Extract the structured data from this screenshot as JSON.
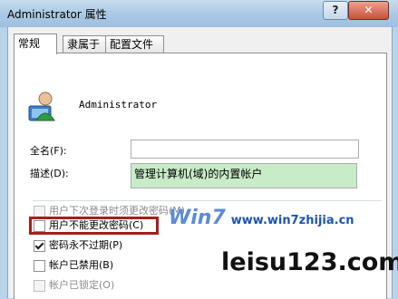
{
  "window": {
    "title": "Administrator 属性",
    "help_label": "?",
    "close_label": "✕"
  },
  "tabs": [
    {
      "label": "常规",
      "active": true
    },
    {
      "label": "隶属于",
      "active": false
    },
    {
      "label": "配置文件",
      "active": false
    }
  ],
  "user": {
    "name": "Administrator",
    "avatar_icon": "user-icon"
  },
  "form": {
    "fullname_label": "全名(F):",
    "fullname_value": "",
    "description_label": "描述(D):",
    "description_value": "管理计算机(域)的内置帐户"
  },
  "options": [
    {
      "label": "用户下次登录时须更改密码(M)",
      "checked": false,
      "disabled": true
    },
    {
      "label": "用户不能更改密码(C)",
      "checked": false,
      "disabled": false,
      "highlighted": true
    },
    {
      "label": "密码永不过期(P)",
      "checked": true,
      "disabled": false
    },
    {
      "label": "帐户已禁用(B)",
      "checked": false,
      "disabled": false
    },
    {
      "label": "帐户已锁定(O)",
      "checked": false,
      "disabled": true
    }
  ],
  "watermarks": {
    "site1": "www.win7zhijia.cn",
    "site1_logo": "Win7",
    "site2": "leisu123.com"
  },
  "colors": {
    "highlight_border": "#a81c1c",
    "description_bg": "#c7ecc7"
  }
}
